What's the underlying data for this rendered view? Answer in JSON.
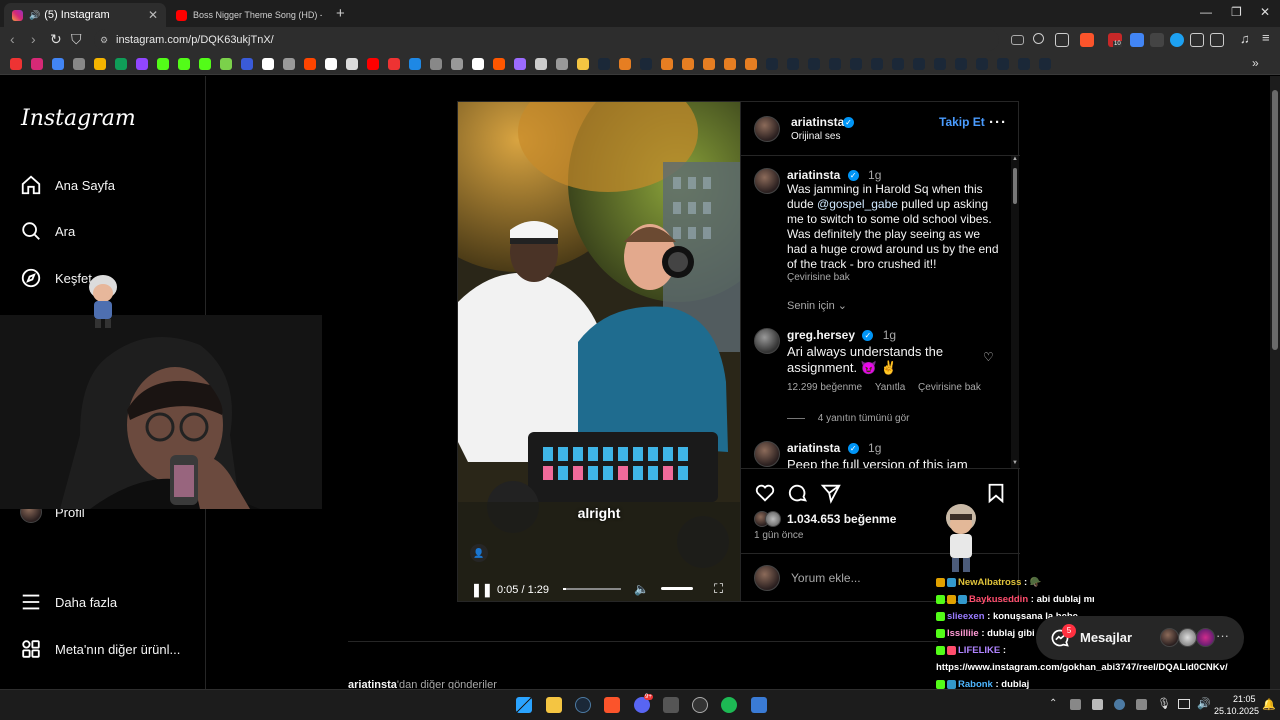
{
  "browser": {
    "tabs": [
      {
        "title": "(5) Instagram",
        "active": true
      },
      {
        "title": "Boss Nigger Theme Song (HD) - You",
        "active": false
      }
    ],
    "new_tab": "+",
    "url": "instagram.com/p/DQK63ukjTnX/",
    "shield_count": "10"
  },
  "sidebar": {
    "logo": "Instagram",
    "items": [
      {
        "label": "Ana Sayfa",
        "icon": "home-icon"
      },
      {
        "label": "Ara",
        "icon": "search-icon"
      },
      {
        "label": "Keşfet",
        "icon": "compass-icon"
      },
      {
        "label": "Profil",
        "icon": "profile-avatar"
      },
      {
        "label": "Daha fazla",
        "icon": "menu-icon"
      },
      {
        "label": "Meta'nın diğer ürünl...",
        "icon": "grid-icon"
      }
    ]
  },
  "post": {
    "author": "ariatinsta",
    "audio": "Orijinal ses",
    "follow_label": "Takip Et",
    "video": {
      "caption_text": "alright",
      "time": "0:05 / 1:29",
      "progress": 0.06
    },
    "caption": {
      "author": "ariatinsta",
      "age": "1g",
      "text_before": "Was jamming in Harold Sq when this dude ",
      "mention": "@gospel_gabe",
      "text_after": " pulled up asking me to switch to some old school vibes. Was definitely the play seeing as we had a huge crowd around us by the end of the track - bro crushed it!!",
      "translate": "Çevirisine bak"
    },
    "filter_label": "Senin için",
    "comments": [
      {
        "author": "greg.hersey",
        "age": "1g",
        "text": "Ari always understands the assignment. 😈 ✌",
        "likes": "12.299 beğenme",
        "reply": "Yanıtla",
        "translate": "Çevirisine bak",
        "view_replies": "4 yanıtın tümünü gör"
      },
      {
        "author": "ariatinsta",
        "age": "1g",
        "text": "Peep the full version of this jam"
      }
    ],
    "likes": "1.034.653 beğenme",
    "time_ago": "1 gün önce",
    "comment_placeholder": "Yorum ekle..."
  },
  "below_post": {
    "more_from_user": "ariatinsta",
    "more_suffix": "'dan diğer gönderiler"
  },
  "chat": [
    {
      "user": "NewAlbatross",
      "message": "🪖",
      "color": "#e0c33b"
    },
    {
      "user": "Baykuseddin",
      "message": "abi dublaj mı",
      "color": "#ff4d6d"
    },
    {
      "user": "slieexen",
      "message": "konuşsana la bebe",
      "color": "#9a7bff"
    },
    {
      "user": "Issilliie",
      "message": "dublaj gibi",
      "color": "#ff9ad5"
    },
    {
      "user": "LIFELIKE",
      "message": "https://www.instagram.com/gokhan_abi3747/reel/DQALld0CNKv/",
      "color": "#b084ff"
    },
    {
      "user": "Rabonk",
      "message": "dublaj",
      "color": "#4db6ff"
    }
  ],
  "messages_pill": {
    "label": "Mesajlar",
    "badge": "5"
  },
  "taskbar": {
    "time": "21:05",
    "date": "25.10.2025",
    "discord_badge": "9+"
  },
  "colors": {
    "accent": "#0095f6",
    "follow": "#4a9cff"
  }
}
